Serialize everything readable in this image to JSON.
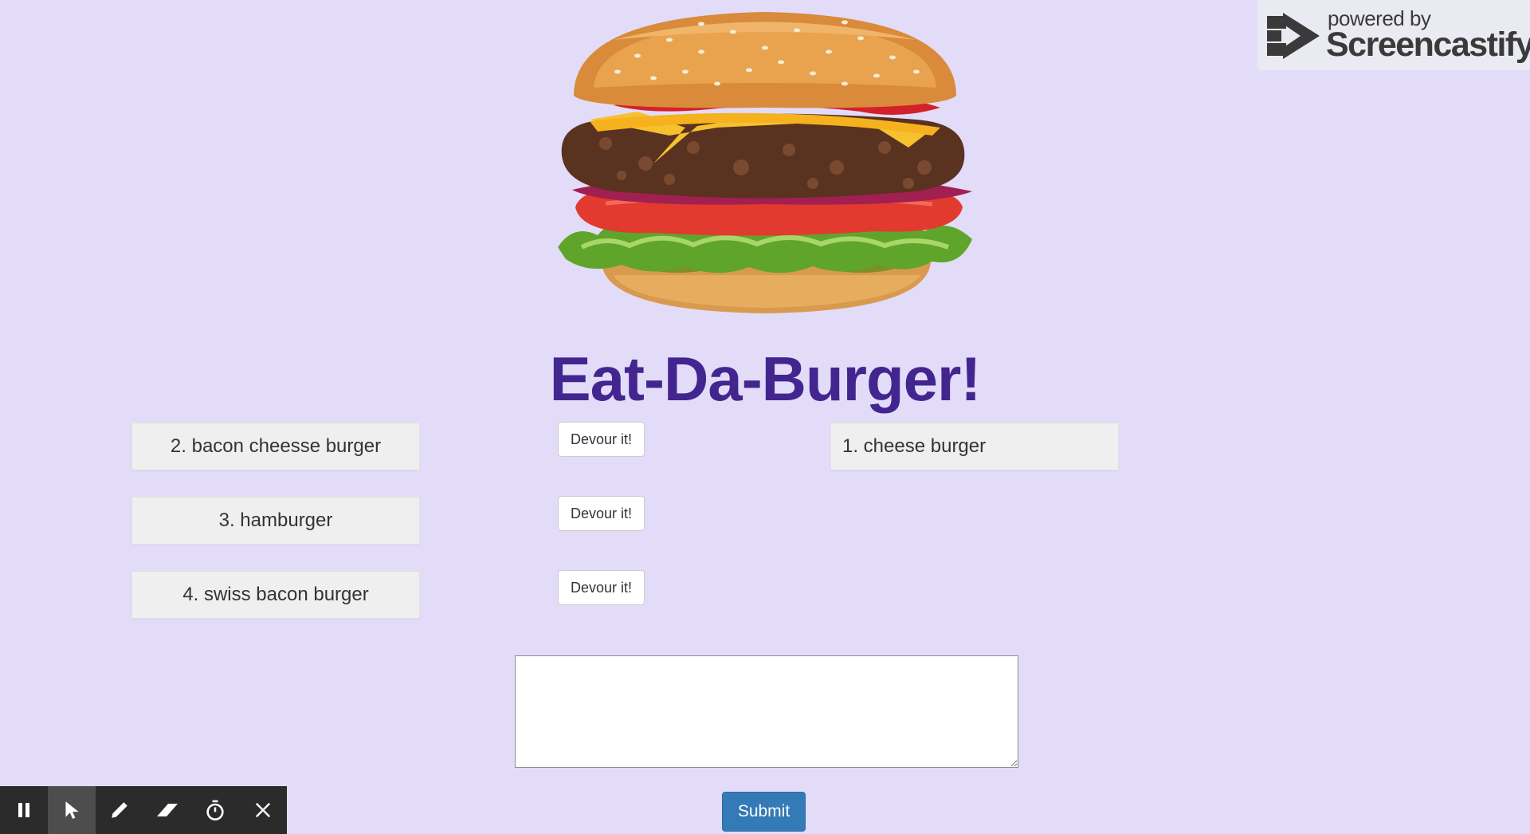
{
  "header": {
    "title": "Eat-Da-Burger!"
  },
  "uneaten_burgers": [
    {
      "label": "2. bacon cheesse burger",
      "button": "Devour it!"
    },
    {
      "label": "3. hamburger",
      "button": "Devour it!"
    },
    {
      "label": "4. swiss bacon burger",
      "button": "Devour it!"
    }
  ],
  "devoured_burgers": [
    {
      "label": "1. cheese burger"
    }
  ],
  "form": {
    "input_value": "",
    "submit_label": "Submit"
  },
  "badge": {
    "powered_by": "powered by",
    "brand": "Screencastify"
  },
  "toolbar": {
    "tools": [
      "pause-icon",
      "cursor-icon",
      "pen-icon",
      "eraser-icon",
      "timer-icon",
      "close-icon"
    ],
    "active_tool": "cursor-icon"
  },
  "colors": {
    "background": "#e2dcf8",
    "title": "#43258f",
    "submit": "#337ab7"
  }
}
